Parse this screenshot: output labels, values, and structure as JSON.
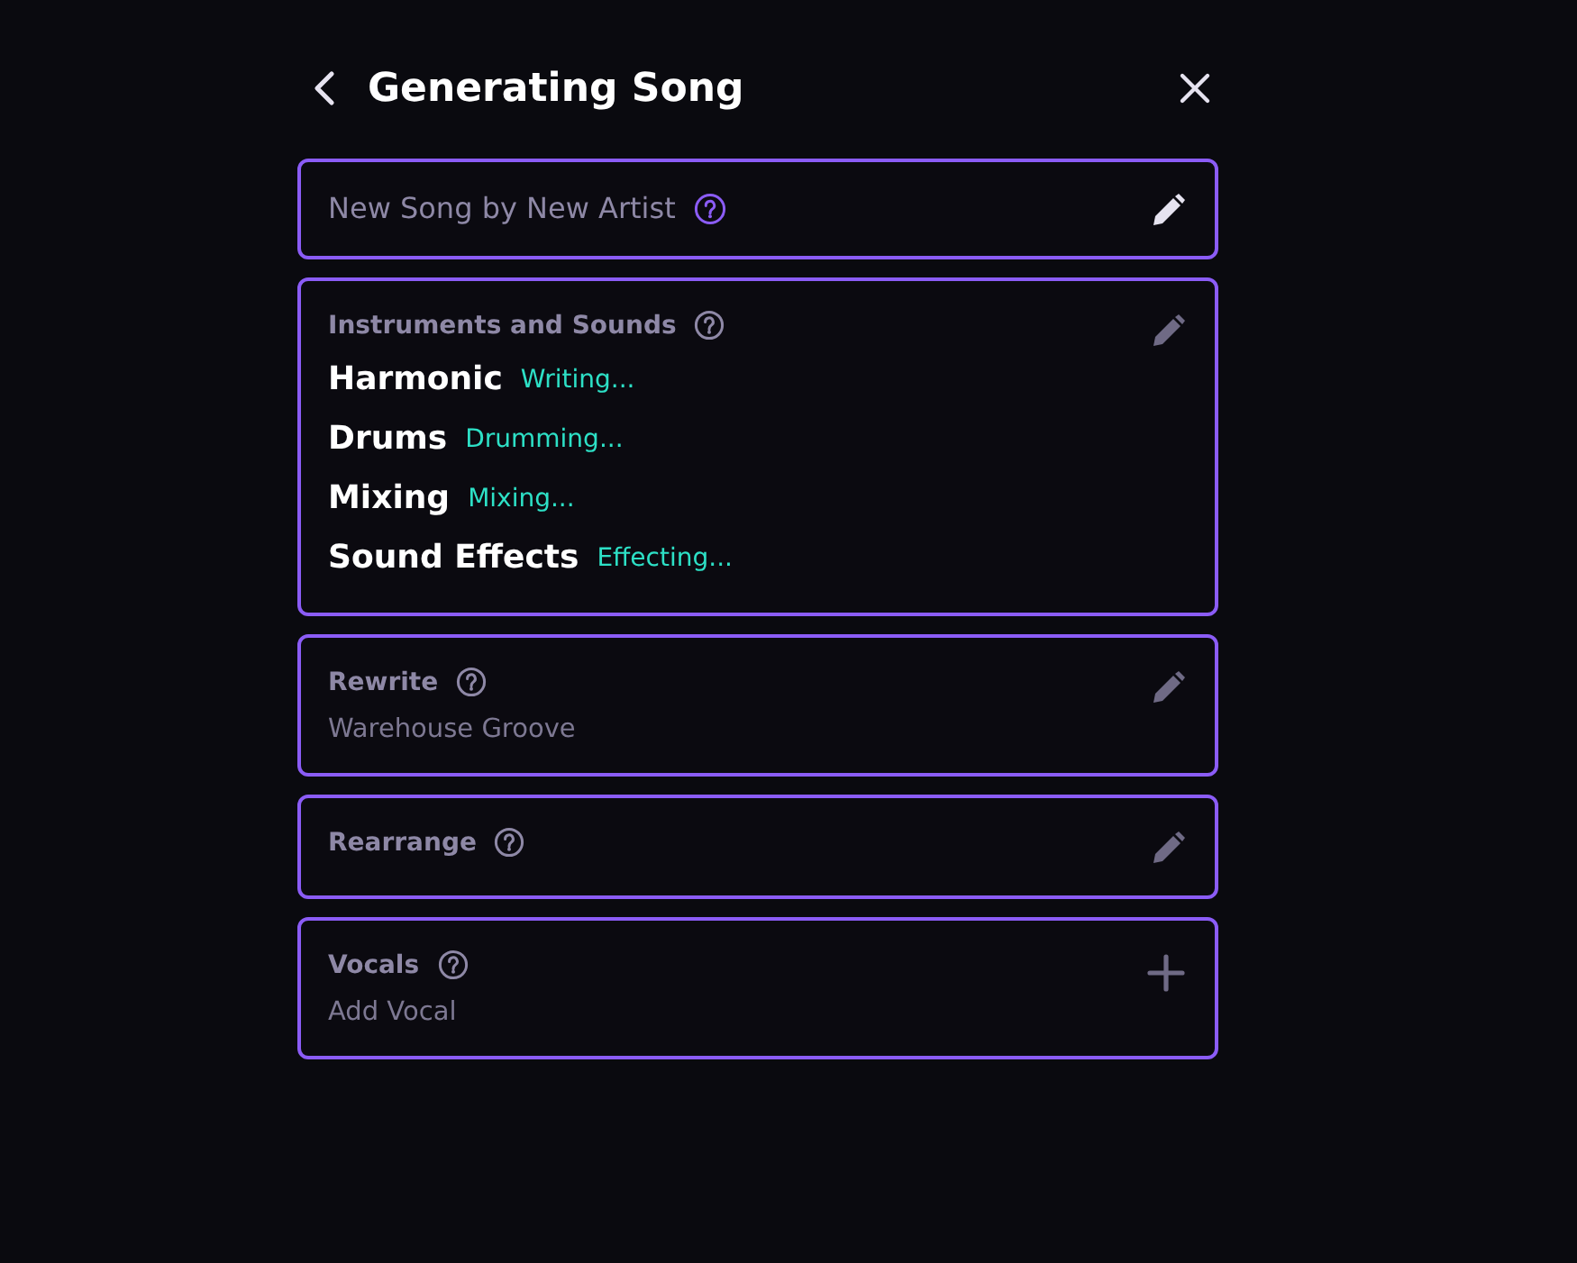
{
  "header": {
    "title": "Generating Song"
  },
  "cards": [
    {
      "kind": "name",
      "text": "New Song by New Artist",
      "action": {
        "kind": "edit"
      }
    },
    {
      "kind": "tracks",
      "title": "Instruments and Sounds",
      "action": {
        "kind": "edit"
      },
      "tracks": [
        {
          "name": "Harmonic",
          "status": "Writing..."
        },
        {
          "name": "Drums",
          "status": "Drumming..."
        },
        {
          "name": "Mixing",
          "status": "Mixing..."
        },
        {
          "name": "Sound Effects",
          "status": "Effecting..."
        }
      ]
    },
    {
      "kind": "section",
      "title": "Rewrite",
      "text": "Warehouse Groove",
      "action": {
        "kind": "edit"
      }
    },
    {
      "kind": "section",
      "title": "Rearrange",
      "action": {
        "kind": "edit"
      }
    },
    {
      "kind": "section",
      "title": "Vocals",
      "text": "Add Vocal",
      "action": {
        "kind": "add"
      }
    }
  ]
}
